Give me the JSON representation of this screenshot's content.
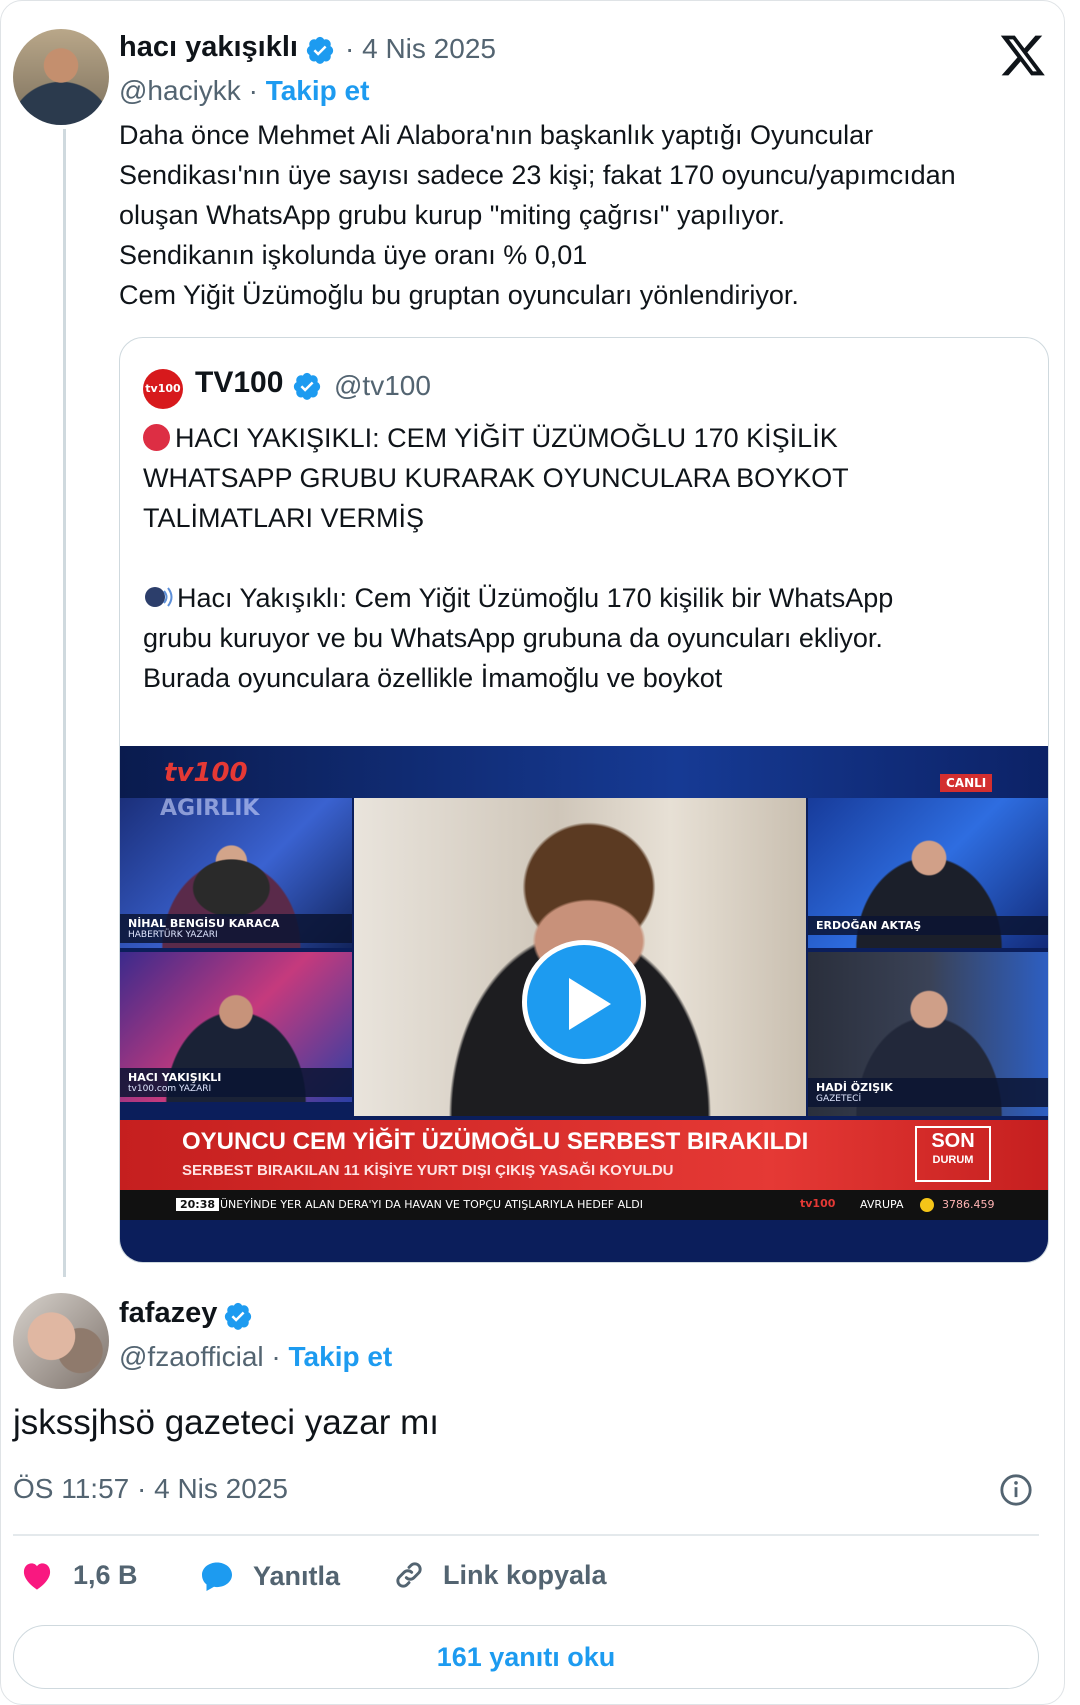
{
  "original_tweet": {
    "author_name": "hacı yakışıklı",
    "date": "· 4 Nis 2025",
    "handle": "@haciykk",
    "separator": " · ",
    "follow_label": "Takip et",
    "text_lines": [
      "Daha önce Mehmet Ali Alabora'nın başkanlık yaptığı Oyuncular",
      "Sendikası'nın üye sayısı sadece 23 kişi; fakat 170 oyuncu/yapımcıdan",
      "oluşan WhatsApp grubu kurup \"miting çağrısı\" yapılıyor.",
      "Sendikanın işkolunda üye oranı % 0,01",
      "Cem Yiğit Üzümoğlu bu gruptan oyuncuları yönlendiriyor."
    ]
  },
  "quoted_tweet": {
    "logo_text": "tv100",
    "author_name": "TV100",
    "handle": "@tv100",
    "headline_lines": [
      "HACI YAKIŞIKLI: CEM YİĞİT ÜZÜMOĞLU 170 KİŞİLİK",
      "WHATSAPP GRUBU KURARAK OYUNCULARA BOYKOT",
      "TALİMATLARI VERMİŞ"
    ],
    "body_lines": [
      "Hacı Yakışıklı: Cem Yiğit Üzümoğlu 170 kişilik bir WhatsApp",
      "grubu kuruyor ve bu WhatsApp grubuna da oyuncuları ekliyor.",
      "Burada oyunculara özellikle İmamoğlu ve boykot"
    ],
    "video": {
      "channel_logo": "tv100",
      "live_badge": "CANLI",
      "panel_top_left_text": "AĞIRLIK",
      "guests": [
        {
          "name": "NİHAL BENGİSU KARACA",
          "role": "HABERTÜRK YAZARI"
        },
        {
          "name": "HACI YAKIŞIKLI",
          "role": "tv100.com YAZARI"
        },
        {
          "name": "ERDOĞAN AKTAŞ",
          "role": ""
        },
        {
          "name": "HADİ ÖZIŞIK",
          "role": "GAZETECİ"
        }
      ],
      "banner_title": "OYUNCU CEM YİĞİT ÜZÜMOĞLU SERBEST BIRAKILDI",
      "banner_subtitle": "SERBEST BIRAKILAN 11 KİŞİYE YURT DIŞI ÇIKIŞ YASAĞI KOYULDU",
      "son_durum_line1": "SON",
      "son_durum_line2": "DURUM",
      "ticker_time": "20:38",
      "ticker_text": "ÜNEYİNDE YER ALAN DERA'YI DA HAVAN VE TOPÇU ATIŞLARIYLA HEDEF ALDI",
      "ticker_brand": "tv100",
      "ticker_market": "AVRUPA",
      "ticker_value": "3786.459",
      "play_icon": "play-icon"
    }
  },
  "reply": {
    "author_name": "fafazey",
    "handle": "@fzaofficial",
    "separator": " · ",
    "follow_label": "Takip et",
    "text": "jskssjhsö gazeteci yazar mı",
    "timestamp": "ÖS 11:57 · 4 Nis 2025"
  },
  "actions": {
    "like_count": "1,6 B",
    "reply_label": "Yanıtla",
    "copy_link_label": "Link kopyala",
    "read_replies_label": "161 yanıtı oku"
  },
  "colors": {
    "accent": "#1d9bf0",
    "like": "#f91880",
    "text": "#0f1419",
    "secondary": "#536471"
  }
}
